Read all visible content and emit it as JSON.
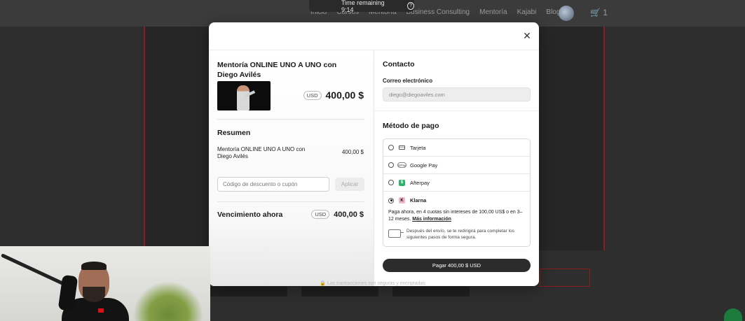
{
  "background": {
    "nav_links": [
      "Inicio",
      "Cursos",
      "Mentoría",
      "Business Consulting",
      "Mentoría",
      "Kajabi",
      "Blog"
    ],
    "cart_count": "1"
  },
  "timer": {
    "label": "Time remaining 9:14",
    "help_icon": "question-circle-icon"
  },
  "modal": {
    "close_icon": "close-icon",
    "order": {
      "product_title": "Mentoría ONLINE UNO A UNO con Diego Avilés",
      "currency": "USD",
      "price": "400,00 $",
      "summary_title": "Resumen",
      "summary_item": "Mentoría ONLINE UNO A UNO con Diego Avilés",
      "summary_price": "400,00 $",
      "discount_placeholder": "Código de descuento o cupón",
      "apply_label": "Aplicar",
      "due_label": "Vencimiento ahora",
      "due_currency": "USD",
      "due_price": "400,00 $"
    },
    "contact": {
      "title": "Contacto",
      "email_label": "Correo electrónico",
      "email_value": "diego@diegoaviles.com"
    },
    "payment": {
      "title": "Método de pago",
      "options": [
        {
          "label": "Tarjeta",
          "icon": "credit-card-icon",
          "selected": false
        },
        {
          "label": "Google Pay",
          "icon": "google-pay-icon",
          "selected": false
        },
        {
          "label": "Afterpay",
          "icon": "afterpay-icon",
          "selected": false
        },
        {
          "label": "Klarna",
          "icon": "klarna-icon",
          "selected": true
        }
      ],
      "klarna_info": "Paga ahora, en 4 cuotas sin intereses de 100,00 US$ o en 3–12 meses.",
      "klarna_more": "Más información",
      "redirect_note": "Después del envío, se te redirigirá para completar los siguientes pasos de forma segura.",
      "pay_button": "Pagar 400,00 $ USD"
    },
    "secure_note": "Las transacciones son seguras y encriptadas"
  }
}
